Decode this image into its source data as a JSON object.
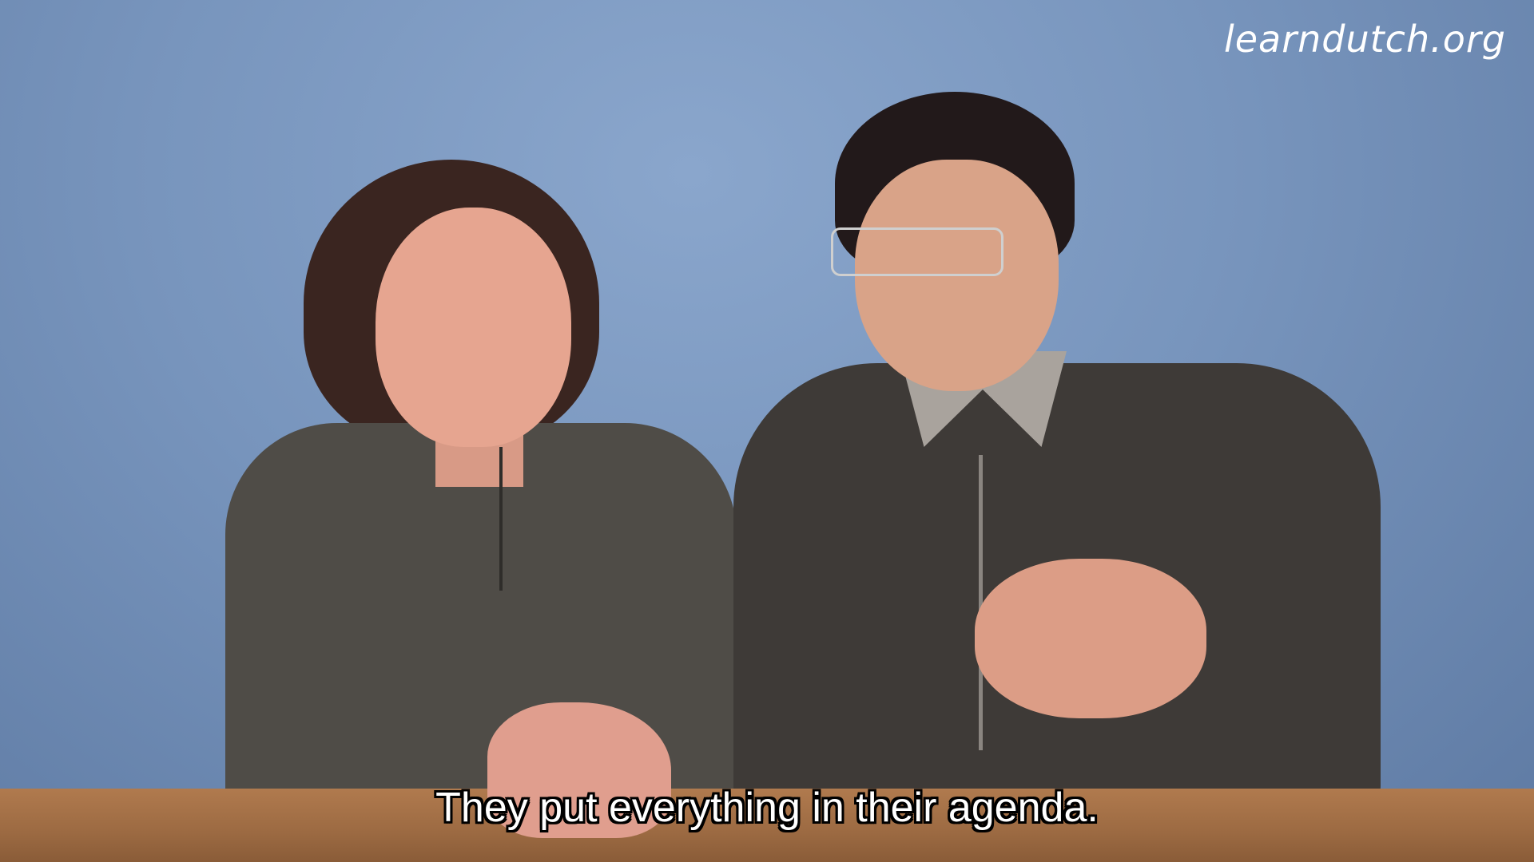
{
  "watermark": "learndutch.org",
  "subtitle": "They put everything in their agenda."
}
